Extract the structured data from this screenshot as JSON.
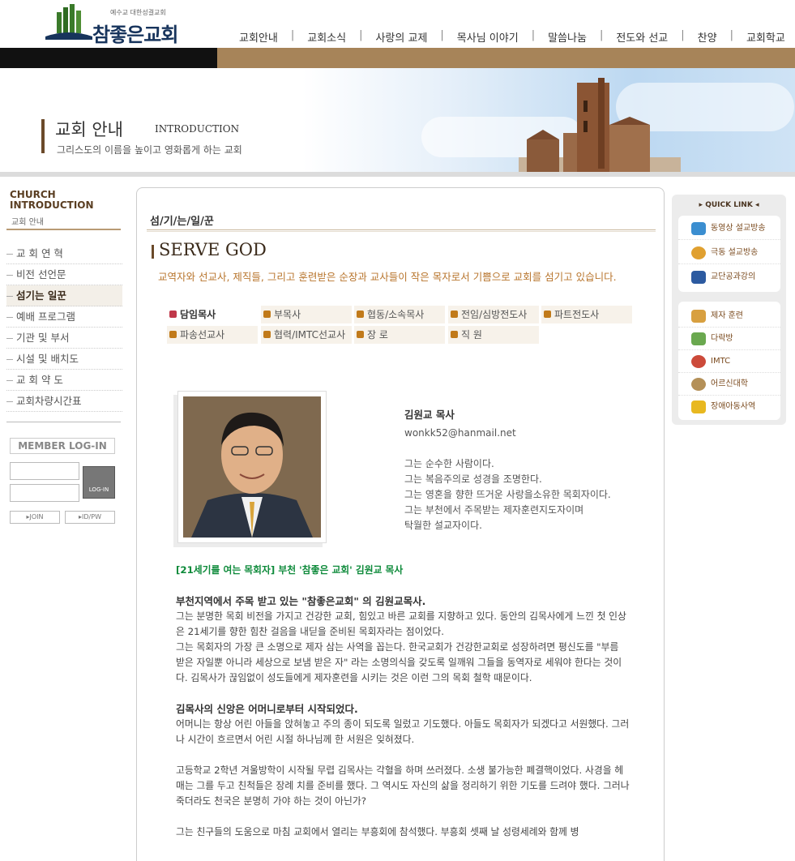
{
  "site": {
    "logo_small": "예수교 대한성결교회",
    "logo_big": "참좋은교회"
  },
  "gnb": [
    "교회안내",
    "교회소식",
    "사랑의 교제",
    "목사님 이야기",
    "말씀나눔",
    "전도와 선교",
    "찬양",
    "교회학교"
  ],
  "banner": {
    "title": "교회 안내",
    "eng": "INTRODUCTION",
    "subtitle": "그리스도의 이름을 높이고 영화롭게 하는 교회"
  },
  "lnb": {
    "heading_line1": "CHURCH",
    "heading_line2": "INTRODUCTION",
    "heading_sub": "교회 안내",
    "items": [
      "교 회 연 혁",
      "비전 선언문",
      "섬기는 일꾼",
      "예배 프로그램",
      "기관 및 부서",
      "시설 및 배치도",
      "교 회 약 도",
      "교회차량시간표"
    ],
    "active_index": 2,
    "login_title": "MEMBER LOG-IN",
    "login_button": "LOG-IN",
    "join": "JOIN",
    "idpw": "ID/PW"
  },
  "content": {
    "breadcrumb": "섬/기/는/일/꾼",
    "section_title": "SERVE GOD",
    "section_desc": "교역자와 선교사, 제직들, 그리고 훈련받은 순장과 교사들이 작은 목자로서 기쁨으로 교회를 섬기고 있습니다.",
    "tabs": [
      "담임목사",
      "부목사",
      "협동/소속목사",
      "전임/심방전도사",
      "파트전도사",
      "파송선교사",
      "협력/IMTC선교사",
      "장 로",
      "직 원"
    ],
    "active_tab": 0,
    "profile": {
      "name": "김원교 목사",
      "email": "wonkk52@hanmail.net",
      "lines": [
        "그는 순수한 사람이다.",
        "그는 복음주의로 성경을 조명한다.",
        "그는 영혼을 향한 뜨거운 사랑을소유한 목회자이다.",
        "그는 부천에서 주목받는 제자훈련지도자이며",
        "탁월한 설교자이다."
      ]
    },
    "article": {
      "headline": "[21세기를 여는 목회자] 부천 '참좋은 교회' 김원교 목사",
      "h1": "부천지역에서 주목 받고 있는 \"참좋은교회\" 의 김원교목사.",
      "p1": "그는 분명한 목회 비전을 가지고 건강한 교회, 힘있고 바른 교회를 지향하고 있다. 동안의 김목사에게 느낀 첫 인상은 21세기를 향한 힘찬 걸음을 내딛을 준비된 목회자라는 점이었다.",
      "p1b": "그는 목회자의 가장 큰 소명으로 제자 삼는 사역을 꼽는다. 한국교회가 건강한교회로 성장하려면 평신도를 \"부름 받은 자일뿐 아니라 세상으로 보냄 받은 자\" 라는 소명의식을 갖도록 일깨워 그들을 동역자로 세워야 한다는 것이다. 김목사가 끊임없이 성도들에게 제자훈련을 시키는 것은 이런 그의 목회 철학 때문이다.",
      "h2": "김목사의 신앙은 어머니로부터 시작되었다.",
      "p2": "어머니는 항상 어린 아들을 앉혀놓고 주의 종이 되도록 일렀고 기도했다. 아들도 목회자가 되겠다고 서원했다. 그러나 시간이 흐르면서 어린 시절 하나님께 한 서원은 잊혀졌다.",
      "p3": "고등학교 2학년 겨울방학이 시작될 무렵 김목사는 각혈을 하며 쓰러졌다. 소생 불가능한 폐결핵이었다. 사경을 헤매는 그를 두고 친척들은 장례 치를 준비를 했다. 그 역시도 자신의 삶을 정리하기 위한 기도를 드려야 했다. 그러나 죽더라도 천국은 분명히 가야 하는 것이 아닌가?",
      "p4": "그는 친구들의 도움으로 마침 교회에서 열리는 부흥회에 참석했다. 부흥회 셋째 날 성령세례와 함께 병"
    }
  },
  "quick": {
    "title": "QUICK LINK",
    "group1": [
      "동영상 설교방송",
      "극동 설교방송",
      "교단공과강의"
    ],
    "group2": [
      "제자 훈련",
      "다락방",
      "IMTC",
      "어르신대학",
      "장애아동사역"
    ]
  },
  "colors": {
    "brand_brown": "#a78459",
    "accent_orange": "#b8752d",
    "headline_green": "#0d8a3a",
    "logo_navy": "#17345c"
  }
}
